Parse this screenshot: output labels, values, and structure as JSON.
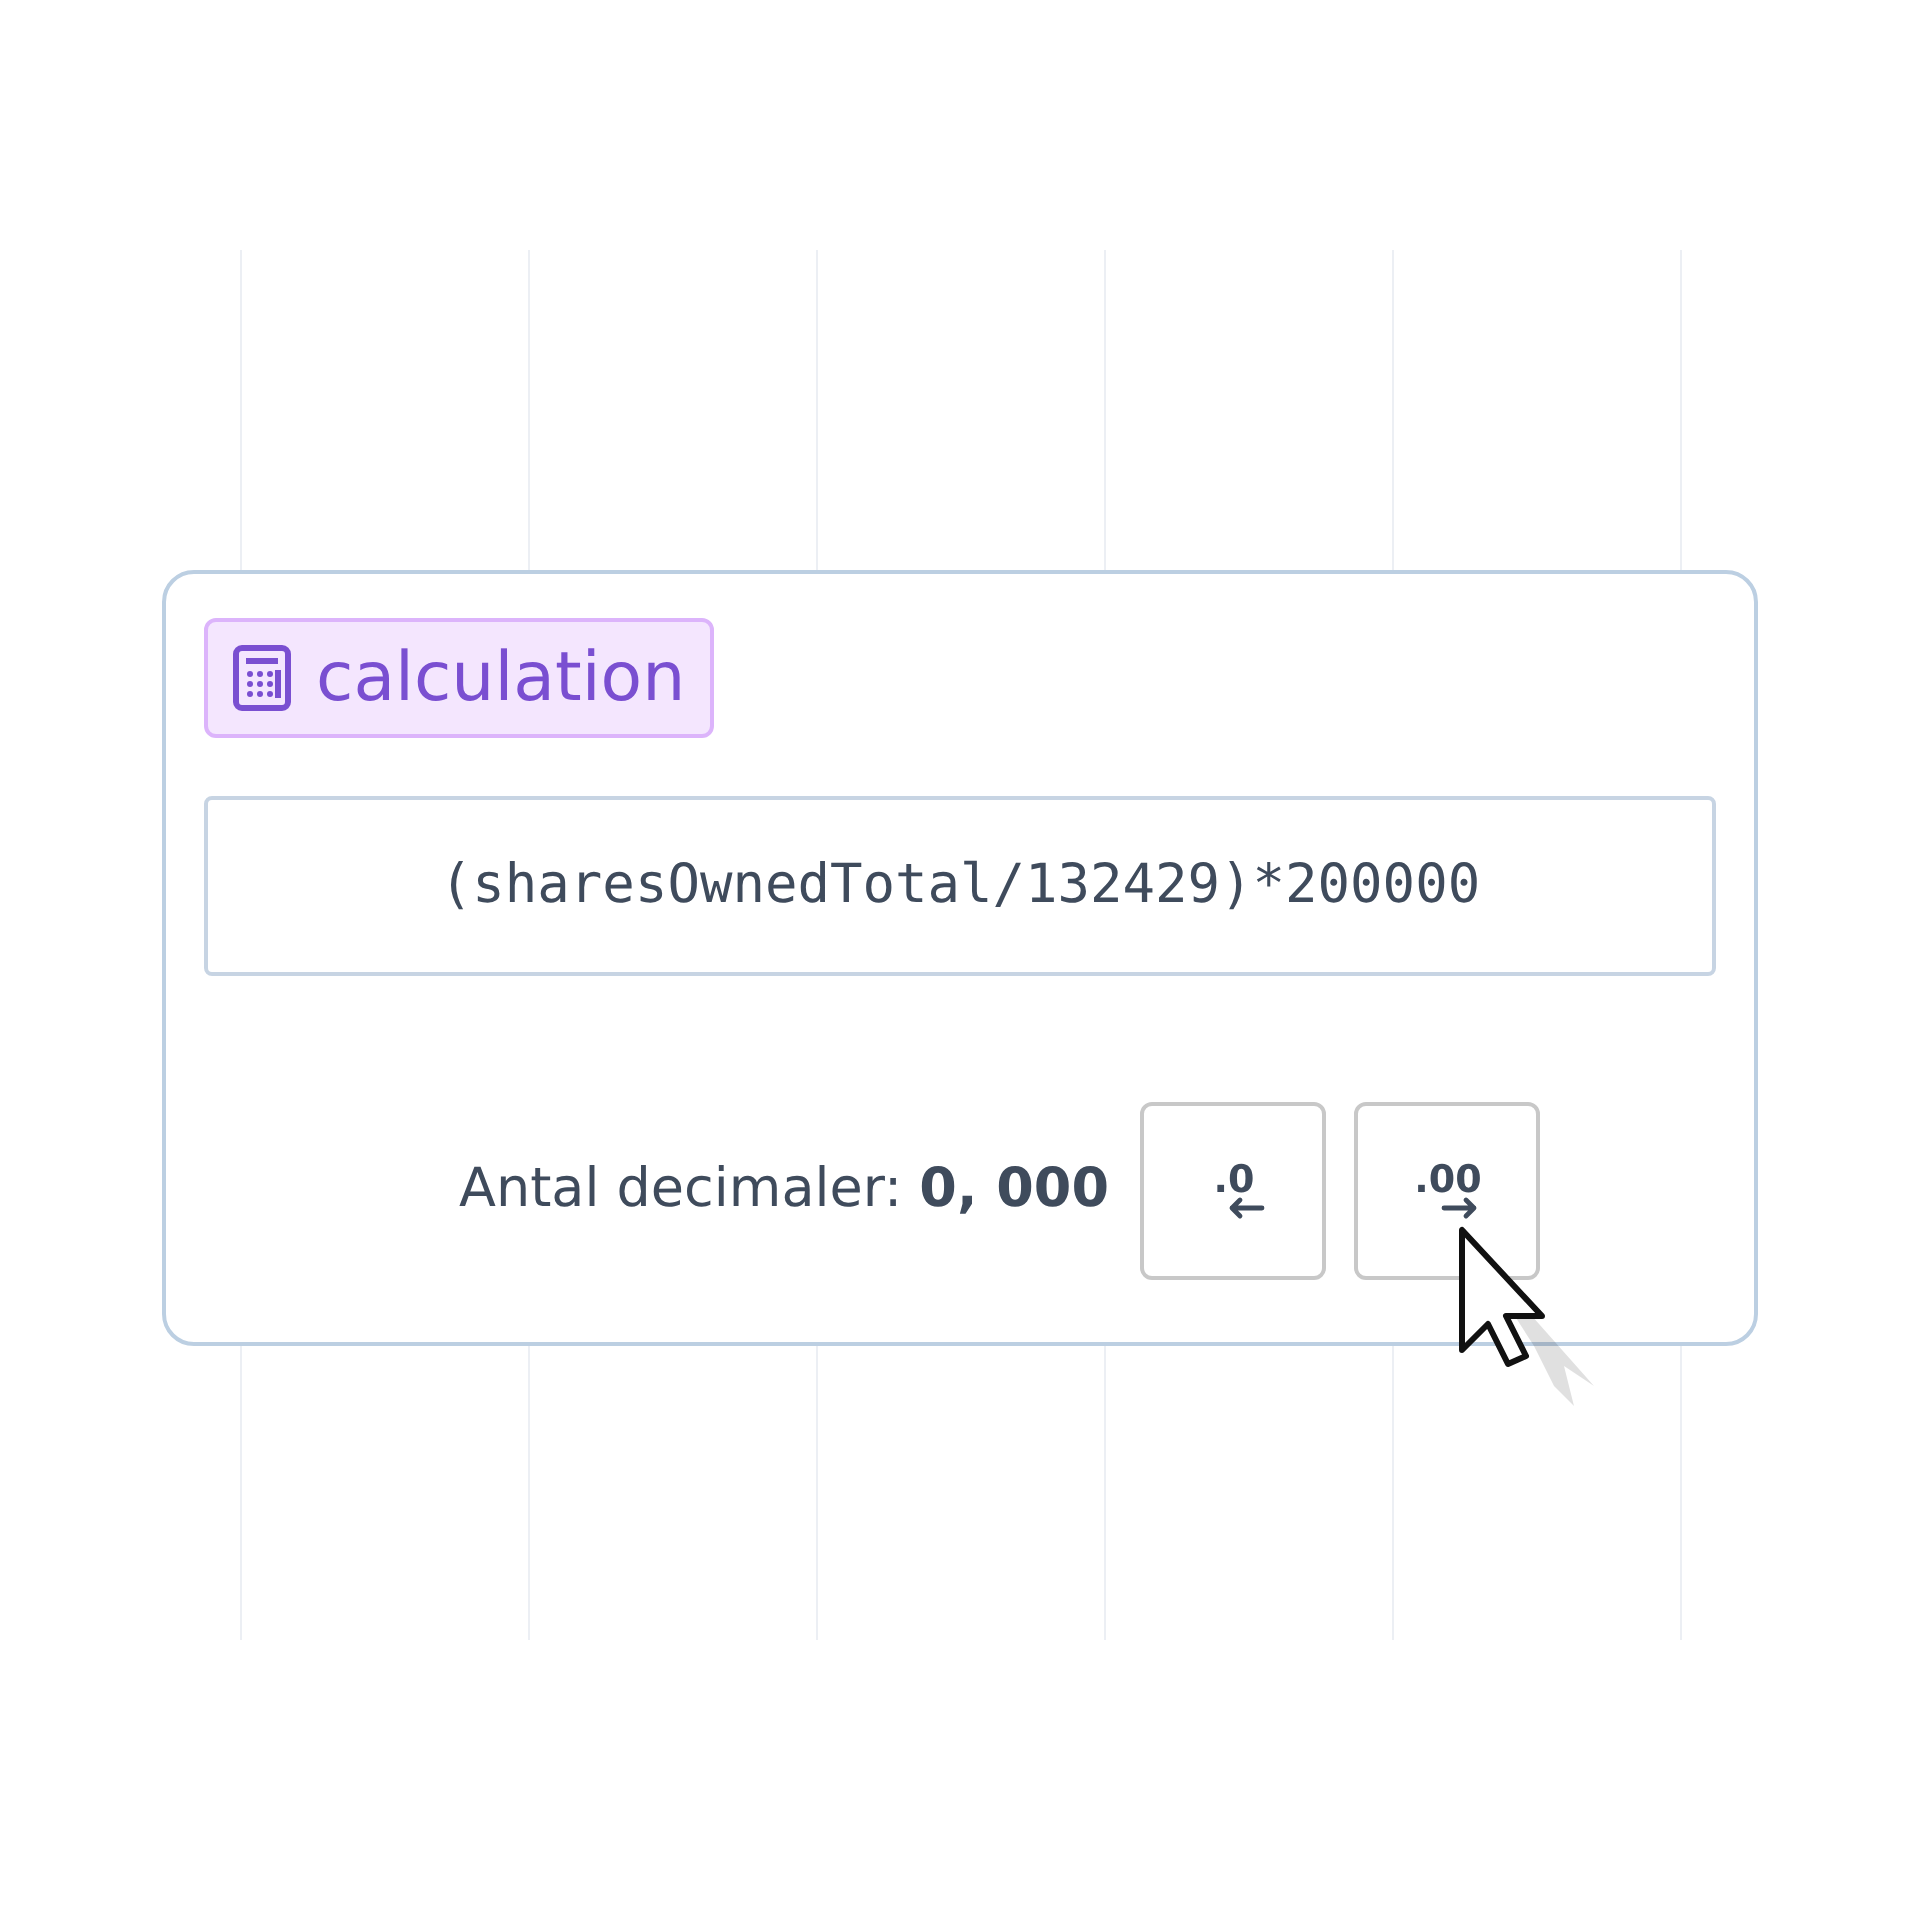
{
  "badge": {
    "label": "calculation"
  },
  "formula": {
    "value": "(sharesOwnedTotal/132429)*200000"
  },
  "decimals": {
    "label": "Antal decimaler: **0, 000**",
    "buttons": [
      {
        "kind": "decrease",
        "label": ".0"
      },
      {
        "kind": "increase",
        "label": ".00"
      }
    ]
  }
}
